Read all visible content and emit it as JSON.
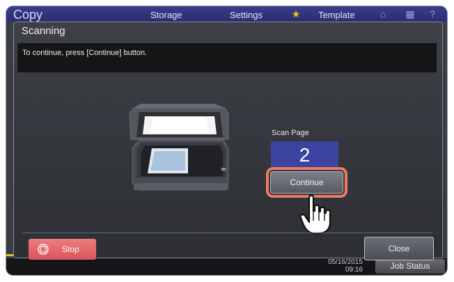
{
  "background": {
    "app_title": "Copy",
    "tabs": [
      "Storage",
      "Settings",
      "Template"
    ],
    "date": "05/16/2015",
    "time": "09:16",
    "job_status_label": "Job Status"
  },
  "dialog": {
    "title": "Scanning",
    "message": "To continue, press [Continue] button.",
    "scan_page_label": "Scan Page",
    "scan_page_count": "2",
    "continue_label": "Continue",
    "stop_label": "Stop",
    "close_label": "Close"
  },
  "colors": {
    "header": "#2a2d70",
    "scan_count_bg": "#3c44a2",
    "highlight_ring": "#ec7a64",
    "stop_button": "#d9545a"
  },
  "icons": {
    "template": "star-icon",
    "stop": "stop-octagon-icon",
    "pointer": "hand-pointer-icon",
    "device": "scanner-icon"
  }
}
